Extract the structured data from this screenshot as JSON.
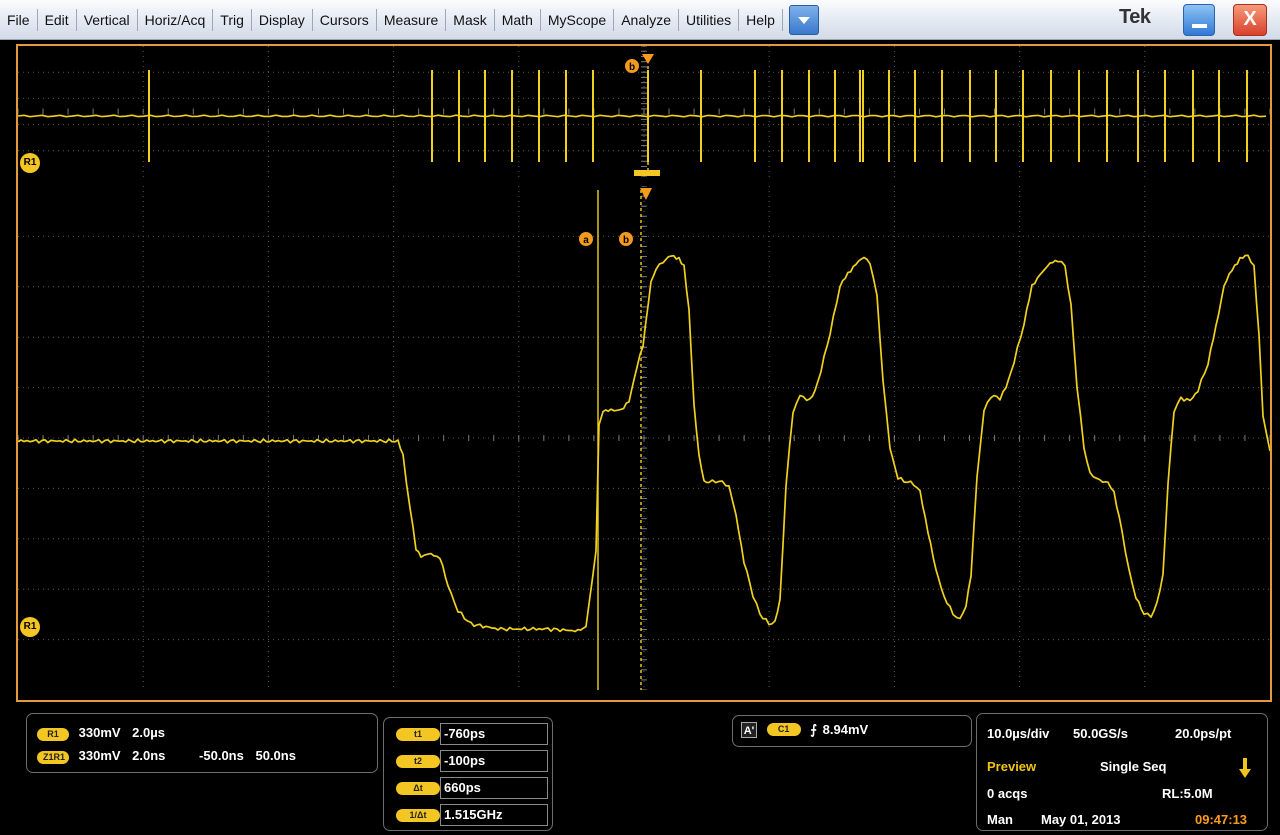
{
  "menu": {
    "items": [
      "File",
      "Edit",
      "Vertical",
      "Horiz/Acq",
      "Trig",
      "Display",
      "Cursors",
      "Measure",
      "Mask",
      "Math",
      "MyScope",
      "Analyze",
      "Utilities",
      "Help"
    ],
    "brand": "Tek",
    "close_glyph": "X"
  },
  "display": {
    "trace_color": "#f0d21e",
    "frame_color": "#e39a3a",
    "reference_label": "R1",
    "cursor_a_label": "a",
    "cursor_b_label": "b"
  },
  "channel_readout": {
    "ref_badge": "R1",
    "ref_scale": "330mV",
    "ref_time": "2.0µs",
    "zoom_badge": "Z1R1",
    "zoom_scale": "330mV",
    "zoom_time": "2.0ns",
    "zoom_position": "-50.0ns",
    "zoom_span": "50.0ns"
  },
  "cursor_readout": {
    "rows": [
      {
        "label": "t1",
        "value": "-760ps"
      },
      {
        "label": "t2",
        "value": "-100ps"
      },
      {
        "label": "Δt",
        "value": "660ps"
      },
      {
        "label": "1/Δt",
        "value": "1.515GHz"
      }
    ]
  },
  "trigger": {
    "mode_badge": "A'",
    "source_badge": "C1",
    "slope_glyph": "⨍",
    "level": "8.94mV"
  },
  "acquisition": {
    "time_per_div": "10.0µs/div",
    "sample_rate": "50.0GS/s",
    "resolution": "20.0ps/pt",
    "mode": "Preview",
    "sequence": "Single Seq",
    "acqs": "0 acqs",
    "record_length": "RL:5.0M",
    "control": "Man",
    "date": "May 01, 2013",
    "time": "09:47:13"
  }
}
